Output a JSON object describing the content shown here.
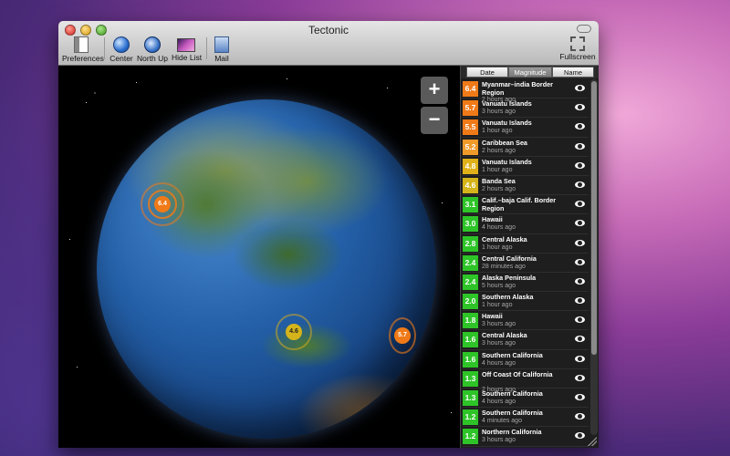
{
  "window": {
    "title": "Tectonic"
  },
  "toolbar": {
    "preferences": "Preferences",
    "center": "Center",
    "north_up": "North Up",
    "hide_list": "Hide List",
    "mail": "Mail",
    "fullscreen": "Fullscreen"
  },
  "map": {
    "zoom_in": "+",
    "zoom_out": "−",
    "markers": [
      {
        "mag": "6.4",
        "color": "#f07a18"
      },
      {
        "mag": "4.6",
        "color": "#e0b018"
      },
      {
        "mag": "5.7",
        "color": "#f07a18"
      }
    ]
  },
  "sort": {
    "date": "Date",
    "magnitude": "Magnitude",
    "name": "Name",
    "active": "Magnitude"
  },
  "quakes": [
    {
      "mag": "6.4",
      "region": "Myanmar–india Border Region",
      "age": "2 hours ago",
      "color": "#f07a18"
    },
    {
      "mag": "5.7",
      "region": "Vanuatu Islands",
      "age": "3 hours ago",
      "color": "#f07a18"
    },
    {
      "mag": "5.5",
      "region": "Vanuatu Islands",
      "age": "1 hour ago",
      "color": "#f07a18"
    },
    {
      "mag": "5.2",
      "region": "Caribbean Sea",
      "age": "2 hours ago",
      "color": "#f09a2a"
    },
    {
      "mag": "4.8",
      "region": "Vanuatu Islands",
      "age": "1 hour ago",
      "color": "#e0b018"
    },
    {
      "mag": "4.6",
      "region": "Banda Sea",
      "age": "2 hours ago",
      "color": "#d4b41a"
    },
    {
      "mag": "3.1",
      "region": "Calif.–baja Calif. Border Region",
      "age": "",
      "color": "#2ec428"
    },
    {
      "mag": "3.0",
      "region": "Hawaii",
      "age": "4 hours ago",
      "color": "#2ec428"
    },
    {
      "mag": "2.8",
      "region": "Central Alaska",
      "age": "1 hour ago",
      "color": "#2ec428"
    },
    {
      "mag": "2.4",
      "region": "Central California",
      "age": "28 minutes ago",
      "color": "#2ec428"
    },
    {
      "mag": "2.4",
      "region": "Alaska Peninsula",
      "age": "5 hours ago",
      "color": "#2ec428"
    },
    {
      "mag": "2.0",
      "region": "Southern Alaska",
      "age": "1 hour ago",
      "color": "#2ec428"
    },
    {
      "mag": "1.8",
      "region": "Hawaii",
      "age": "3 hours ago",
      "color": "#2ec428"
    },
    {
      "mag": "1.6",
      "region": "Central Alaska",
      "age": "3 hours ago",
      "color": "#2ec428"
    },
    {
      "mag": "1.6",
      "region": "Southern California",
      "age": "4 hours ago",
      "color": "#2ec428"
    },
    {
      "mag": "1.3",
      "region": "Off Coast Of California",
      "age": "2 hours ago",
      "color": "#2ec428"
    },
    {
      "mag": "1.3",
      "region": "Southern California",
      "age": "4 hours ago",
      "color": "#2ec428"
    },
    {
      "mag": "1.2",
      "region": "Southern California",
      "age": "4 minutes ago",
      "color": "#2ec428"
    },
    {
      "mag": "1.2",
      "region": "Northern California",
      "age": "3 hours ago",
      "color": "#2ec428"
    }
  ]
}
